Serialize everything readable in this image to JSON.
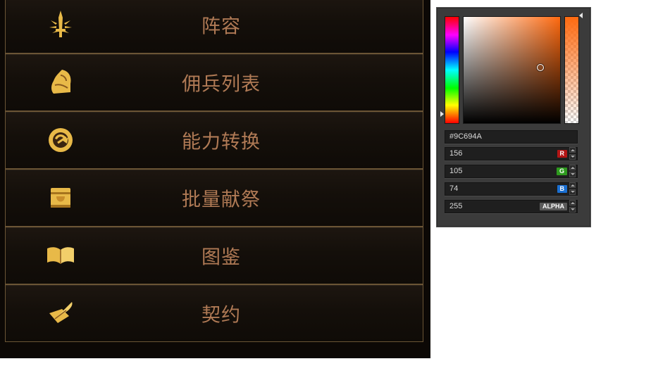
{
  "menu": {
    "items": [
      {
        "label": "阵容",
        "icon": "sword-burst-icon"
      },
      {
        "label": "佣兵列表",
        "icon": "warrior-helmet-icon"
      },
      {
        "label": "能力转换",
        "icon": "swap-cycle-icon"
      },
      {
        "label": "批量献祭",
        "icon": "treasure-chest-icon"
      },
      {
        "label": "图鉴",
        "icon": "open-book-icon"
      },
      {
        "label": "契约",
        "icon": "quill-scroll-icon"
      }
    ],
    "colors": {
      "label": "#b07a55",
      "border": "#6b5535",
      "icon_gold": "#e8b948"
    }
  },
  "color_picker": {
    "hex": "#9C694A",
    "red": {
      "value": "156",
      "badge": "R",
      "color": "#b31515"
    },
    "green": {
      "value": "105",
      "badge": "G",
      "color": "#2e9a1e"
    },
    "blue": {
      "value": "74",
      "badge": "B",
      "color": "#1a6fd1"
    },
    "alpha": {
      "value": "255",
      "badge": "ALPHA",
      "color": "#5a5a5a"
    },
    "hue_color": "#ff6a10"
  }
}
